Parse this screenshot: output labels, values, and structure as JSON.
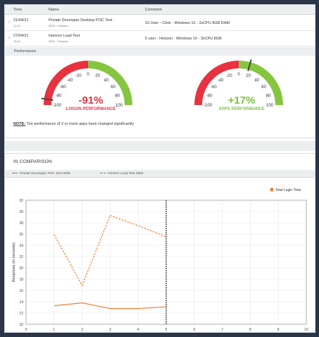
{
  "table": {
    "headers": {
      "time": "Time",
      "name": "Name",
      "comment": "Comment"
    },
    "rows": [
      {
        "date": "21/04/21",
        "time": "12:10",
        "name": "Private Developer Desktop POC Test",
        "sub": "0009 - Finished",
        "comment": "10 User - Citrix - Windows 10 - 3xCPU 8GB RAM"
      },
      {
        "date": "27/04/21",
        "time": "15:24",
        "name": "Horizon Load Test",
        "sub": "0002 - Finished",
        "comment": "5 user - Horizon - Windows 10 - 3xCPU 8GB"
      }
    ]
  },
  "performance": {
    "heading": "Performance",
    "gauges": [
      {
        "value_label": "-91%",
        "caption": "LOGON PERFORMANCE",
        "value": -91,
        "color": "#e03545",
        "ticks": [
          "-100",
          "-80",
          "-60",
          "-40",
          "-20",
          "0",
          "20",
          "40",
          "60",
          "80",
          "100"
        ]
      },
      {
        "value_label": "+17%",
        "caption": "APPS PERFORMANCE",
        "value": 17,
        "color": "#7cc242",
        "ticks": [
          "-100",
          "-80",
          "-60",
          "-40",
          "-20",
          "0",
          "20",
          "40",
          "60",
          "80",
          "100"
        ]
      }
    ],
    "note_label": "NOTE:",
    "note_text": " The performance of 2 or more apps have changed significantly",
    "colors": {
      "negative": "#e8323f",
      "positive": "#86c540"
    }
  },
  "comparison": {
    "title": "IN COMPARISON",
    "legend": [
      {
        "label": "Private Developer POC Test 0009",
        "style": "solid"
      },
      {
        "label": "Horizon Load Test 0002",
        "style": "dashed"
      }
    ]
  },
  "chart_data": {
    "type": "line",
    "series_legend": "Total Login Time",
    "ylabel": "Response (in seconds)",
    "xlim": [
      0,
      10
    ],
    "ylim": [
      10,
      32
    ],
    "x_ticks": [
      "0",
      "1",
      "2",
      "3",
      "4",
      "5",
      "6",
      "7",
      "8",
      "9",
      "10"
    ],
    "y_ticks": [
      "10",
      "12",
      "14",
      "16",
      "18",
      "20",
      "22",
      "24",
      "26",
      "28",
      "30",
      "32"
    ],
    "series": [
      {
        "style": "solid",
        "color": "#ef7d35",
        "points": [
          [
            1,
            13.3
          ],
          [
            2,
            13.8
          ],
          [
            3,
            12.8
          ],
          [
            4,
            12.8
          ],
          [
            5,
            13.1
          ]
        ]
      },
      {
        "style": "dashed",
        "color": "#ef7d35",
        "points": [
          [
            1,
            25.9
          ],
          [
            2,
            16.9
          ],
          [
            3,
            29.3
          ],
          [
            4,
            27.5
          ],
          [
            5,
            25.5
          ]
        ]
      }
    ],
    "marker_x": 5,
    "grid": true,
    "legend_position": "top-right",
    "colors": {
      "line": "#ef7d35",
      "marker": "#555555"
    }
  }
}
